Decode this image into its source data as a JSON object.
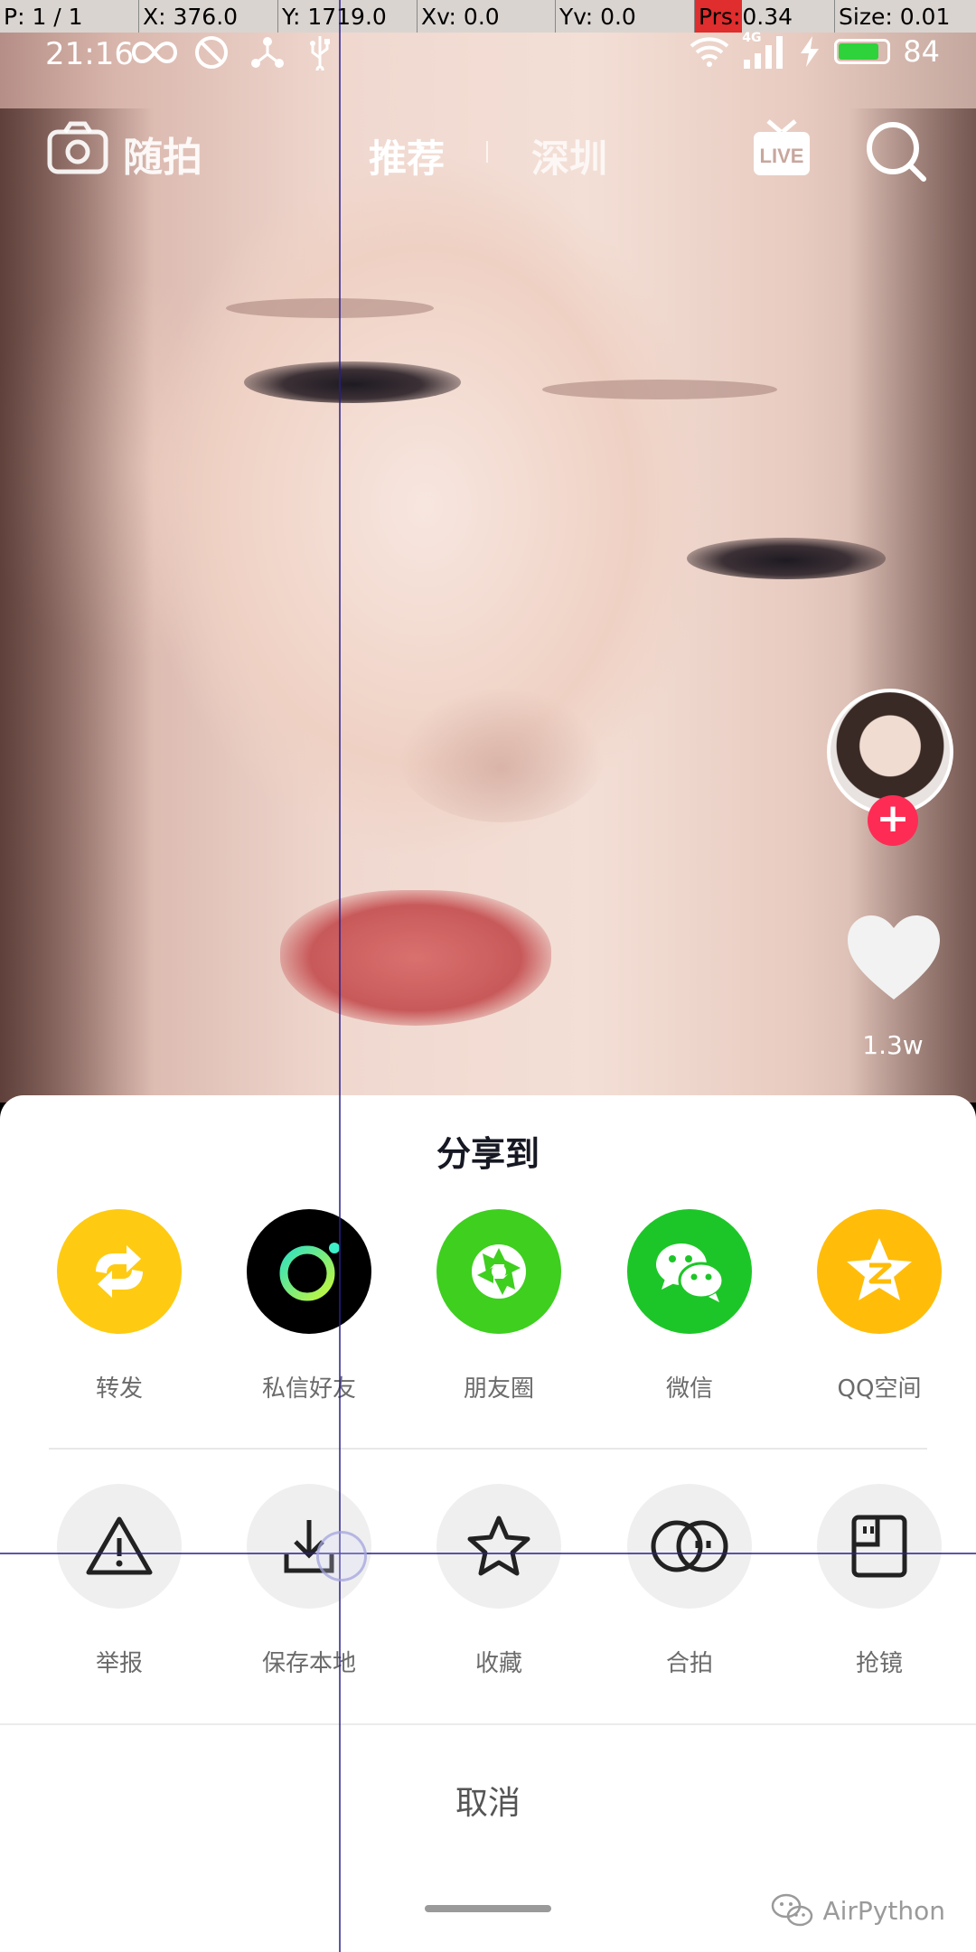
{
  "debug_bar": {
    "pointer": "P: 1 / 1",
    "x": "X: 376.0",
    "y": "Y: 1719.0",
    "xv": "Xv: 0.0",
    "yv": "Yv: 0.0",
    "prs_label": "Prs:",
    "prs_value": " 0.34",
    "size": "Size: 0.01"
  },
  "status_bar": {
    "time": "21:16",
    "network": "4G",
    "battery_level": "84",
    "battery_color": "#2ed23a",
    "icons": [
      "infinity-icon",
      "blocked-icon",
      "share-nodes-icon",
      "usb-icon",
      "wifi-icon",
      "signal-icon",
      "charging-icon",
      "battery-icon"
    ]
  },
  "top_nav": {
    "camera_label": "随拍",
    "tab_recommend": "推荐",
    "tab_city": "深圳",
    "live_label": "LIVE"
  },
  "right_rail": {
    "likes": "1.3w",
    "follow_color": "#fe2c55"
  },
  "share_sheet": {
    "title": "分享到",
    "share_targets": [
      {
        "label": "转发",
        "icon": "repost-icon",
        "color": "#fecb12"
      },
      {
        "label": "私信好友",
        "icon": "message-friend-icon",
        "color": "#000000"
      },
      {
        "label": "朋友圈",
        "icon": "moments-icon",
        "color": "#3ecf1f"
      },
      {
        "label": "微信",
        "icon": "wechat-icon",
        "color": "#1dc628"
      },
      {
        "label": "QQ空间",
        "icon": "qzone-icon",
        "color": "#ffbd0a"
      }
    ],
    "actions": [
      {
        "label": "举报",
        "icon": "report-icon"
      },
      {
        "label": "保存本地",
        "icon": "download-icon"
      },
      {
        "label": "收藏",
        "icon": "star-icon"
      },
      {
        "label": "合拍",
        "icon": "duet-icon"
      },
      {
        "label": "抢镜",
        "icon": "react-icon"
      }
    ],
    "cancel": "取消"
  },
  "watermark": {
    "text": "AirPython"
  }
}
